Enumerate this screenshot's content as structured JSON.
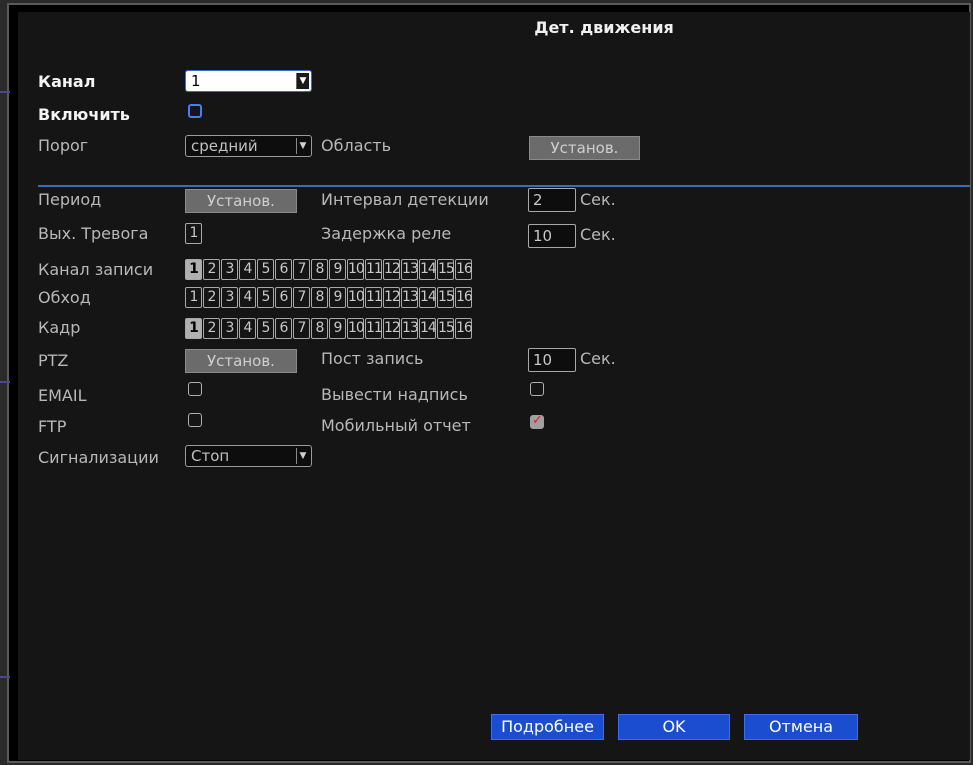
{
  "window": {
    "title": "Дет. движения"
  },
  "fields": {
    "channel_label": "Канал",
    "channel_value": "1",
    "enable_label": "Включить",
    "threshold_label": "Порог",
    "threshold_value": "средний",
    "area_label": "Область",
    "area_button": "Установ.",
    "period_label": "Период",
    "period_button": "Установ.",
    "interval_label": "Интервал детекции",
    "interval_value": "2",
    "interval_unit": "Сек.",
    "alarm_out_label": "Вых. Тревога",
    "alarm_out_value": "1",
    "relay_delay_label": "Задержка реле",
    "relay_delay_value": "10",
    "relay_delay_unit": "Сек.",
    "record_channel_label": "Канал записи",
    "tour_label": "Обход",
    "snapshot_label": "Кадр",
    "ptz_label": "PTZ",
    "ptz_button": "Установ.",
    "post_record_label": "Пост запись",
    "post_record_value": "10",
    "post_record_unit": "Сек.",
    "email_label": "EMAIL",
    "show_text_label": "Вывести надпись",
    "ftp_label": "FTP",
    "mobile_report_label": "Мобильный отчет",
    "alarm_label": "Сигнализации",
    "alarm_value": "Стоп"
  },
  "channels": [
    "1",
    "2",
    "3",
    "4",
    "5",
    "6",
    "7",
    "8",
    "9",
    "10",
    "11",
    "12",
    "13",
    "14",
    "15",
    "16"
  ],
  "record_channel_selected": [
    1
  ],
  "tour_selected": [],
  "snapshot_selected": [
    1
  ],
  "checkboxes": {
    "enable": false,
    "email": false,
    "show_text": false,
    "ftp": false,
    "mobile_report": true
  },
  "buttons": {
    "details": "Подробнее",
    "ok": "OK",
    "cancel": "Отмена"
  },
  "colors": {
    "accent_blue": "#1a4dd0",
    "separator": "#3a6cb8",
    "check_mark": "#e02020"
  }
}
